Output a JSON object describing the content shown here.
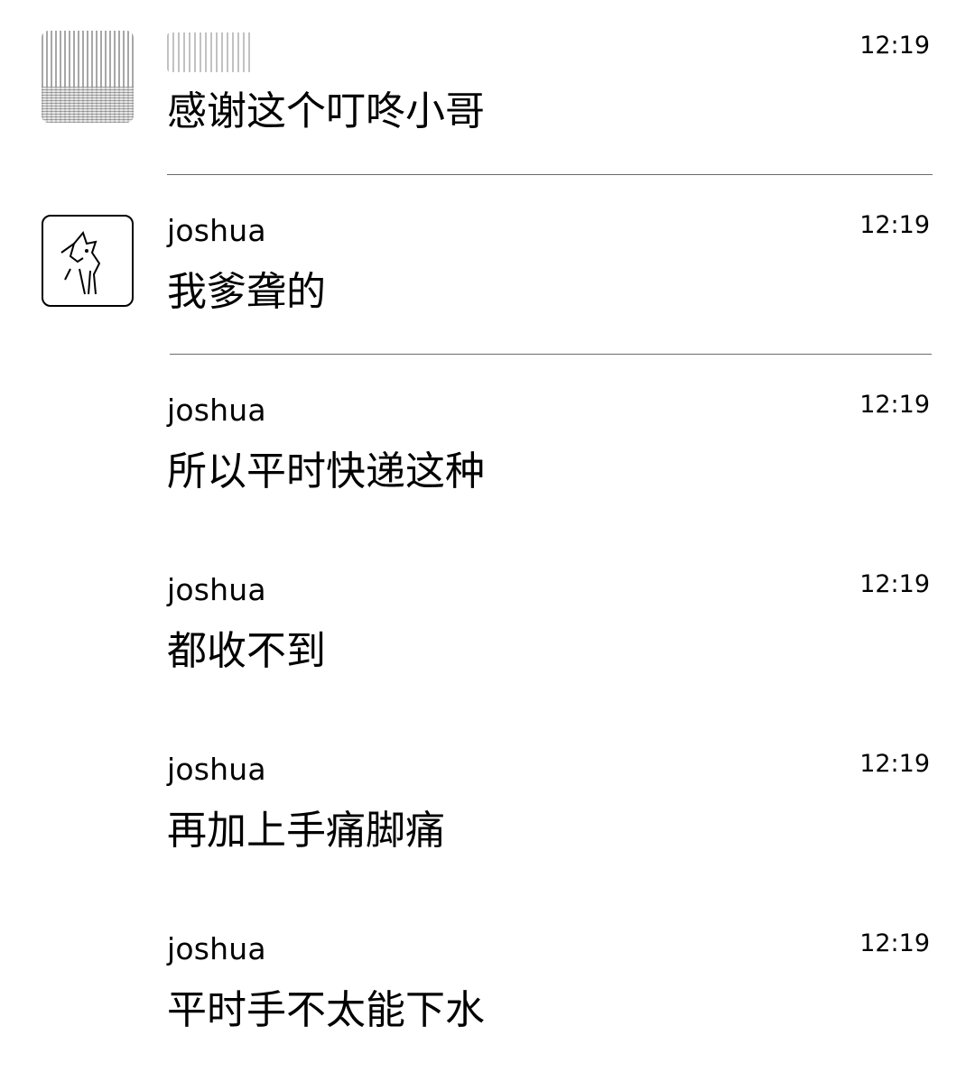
{
  "messages": [
    {
      "sender": "",
      "time": "12:19",
      "text": "感谢这个叮咚小哥"
    },
    {
      "sender": "joshua",
      "time": "12:19",
      "text": "我爹聋的"
    },
    {
      "sender": "joshua",
      "time": "12:19",
      "text": "所以平时快递这种"
    },
    {
      "sender": "joshua",
      "time": "12:19",
      "text": "都收不到"
    },
    {
      "sender": "joshua",
      "time": "12:19",
      "text": "再加上手痛脚痛"
    },
    {
      "sender": "joshua",
      "time": "12:19",
      "text": "平时手不太能下水"
    }
  ]
}
